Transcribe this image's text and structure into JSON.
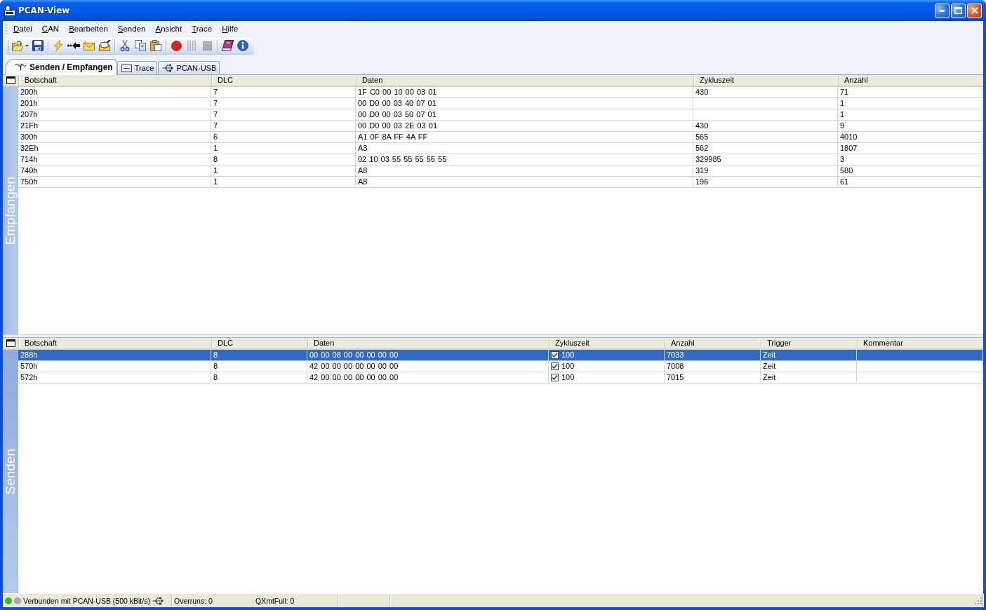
{
  "window": {
    "title": "PCAN-View"
  },
  "menu": [
    "Datei",
    "CAN",
    "Bearbeiten",
    "Senden",
    "Ansicht",
    "Trace",
    "Hilfe"
  ],
  "toolbar": [
    [
      {
        "disabled": false
      },
      {
        "disabled": false
      }
    ],
    [
      {
        "disabled": false
      },
      {
        "disabled": false
      },
      {
        "disabled": false
      },
      {
        "disabled": false
      }
    ],
    [
      {
        "disabled": false
      },
      {
        "disabled": false
      },
      {
        "disabled": false
      }
    ],
    [
      {
        "disabled": false
      },
      {
        "disabled": true
      },
      {
        "disabled": true
      }
    ],
    [
      {
        "disabled": false
      },
      {
        "disabled": false
      }
    ]
  ],
  "tabs": [
    {
      "label": "Senden / Empfangen",
      "selected": true
    },
    {
      "label": "Trace",
      "selected": false
    },
    {
      "label": "PCAN-USB",
      "selected": false
    }
  ],
  "receive": {
    "active": false,
    "side_label": "Empfangen",
    "columns": [
      "Botschaft",
      "DLC",
      "Daten",
      "Zykluszeit",
      "Anzahl"
    ],
    "rows": [
      {
        "message": "200h",
        "dlc": "7",
        "data": "1F C0 00 10 00 03 01",
        "cycle_time": "430",
        "count": "71"
      },
      {
        "message": "201h",
        "dlc": "7",
        "data": "00 D0 00 03 40 07 01",
        "count": "1"
      },
      {
        "message": "207h",
        "dlc": "7",
        "data": "00 D0 00 03 50 07 01",
        "count": "1"
      },
      {
        "message": "21Fh",
        "dlc": "7",
        "data": "00 D0 00 03 2E 03 01",
        "cycle_time": "430",
        "count": "9"
      },
      {
        "message": "300h",
        "dlc": "6",
        "data": "A1 0F 8A FF 4A FF",
        "cycle_time": "565",
        "count": "4010"
      },
      {
        "message": "32Eh",
        "dlc": "1",
        "data": "A3",
        "cycle_time": "562",
        "count": "1807"
      },
      {
        "message": "714h",
        "dlc": "8",
        "data": "02 10 03 55 55 55 55 55",
        "cycle_time": "329985",
        "count": "3"
      },
      {
        "message": "740h",
        "dlc": "1",
        "data": "A8",
        "cycle_time": "319",
        "count": "580"
      },
      {
        "message": "750h",
        "dlc": "1",
        "data": "A8",
        "cycle_time": "196",
        "count": "61"
      }
    ]
  },
  "transmit": {
    "active": true,
    "side_label": "Senden",
    "columns": [
      "Botschaft",
      "DLC",
      "Daten",
      "Zykluszeit",
      "Anzahl",
      "Trigger",
      "Kommentar"
    ],
    "rows": [
      {
        "selected": true,
        "message": "288h",
        "dlc": "8",
        "data": "00 00 08 00 00 00 00 00",
        "cycle_enabled": true,
        "cycle_time": "100",
        "count": "7033",
        "trigger": "Zeit"
      },
      {
        "selected": false,
        "message": "570h",
        "dlc": "8",
        "data": "42 00 00 00 00 00 00 00",
        "cycle_enabled": true,
        "cycle_time": "100",
        "count": "7008",
        "trigger": "Zeit"
      },
      {
        "selected": false,
        "message": "572h",
        "dlc": "8",
        "data": "42 00 00 00 00 00 00 00",
        "cycle_enabled": true,
        "cycle_time": "100",
        "count": "7015",
        "trigger": "Zeit"
      }
    ]
  },
  "status_bar": {
    "leds": [
      {
        "color": "#33bb33"
      },
      {
        "color": "#a9a9a9"
      }
    ],
    "connection": "Verbunden mit PCAN-USB (500 kBit/s)",
    "overruns": "Overruns: 0",
    "qxmtfull": "QXmtFull: 0"
  }
}
